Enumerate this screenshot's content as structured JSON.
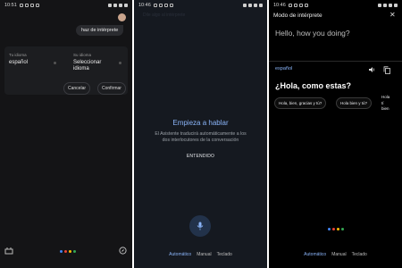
{
  "panel1": {
    "time": "10:51",
    "user_bubble": "haz de intérprete",
    "your_language_label": "Tu idioma",
    "your_language_value": "español",
    "their_language_label": "Su idioma",
    "their_language_value_line1": "Seleccionar",
    "their_language_value_line2": "idioma",
    "cancel_label": "Cancelar",
    "confirm_label": "Confirmar"
  },
  "panel2": {
    "time": "10:46",
    "ghost_text": "Dile algo al intérprete",
    "start_title": "Empieza a hablar",
    "description": "El Asistente traducirá automáticamente a los dos interlocutores de la conversación",
    "ok_label": "ENTENDIDO",
    "tabs": [
      "Automático",
      "Manual",
      "Teclado"
    ]
  },
  "panel3": {
    "time": "10:46",
    "header_title": "Modo de intérprete",
    "source_text": "Hello, how you doing?",
    "target_language": "español",
    "translated_text": "¿Hola, como estas?",
    "suggestions": [
      "Hola, bien, gracias y tú?",
      "Hola bien y tú?",
      "Hola",
      "tí",
      "bien"
    ],
    "tabs": [
      "Automático",
      "Manual",
      "Teclado"
    ]
  },
  "colors": {
    "accent_blue": "#8ab4f8",
    "google_blue": "#4285f4",
    "google_red": "#ea4335",
    "google_yellow": "#fbbc04",
    "google_green": "#34a853"
  }
}
